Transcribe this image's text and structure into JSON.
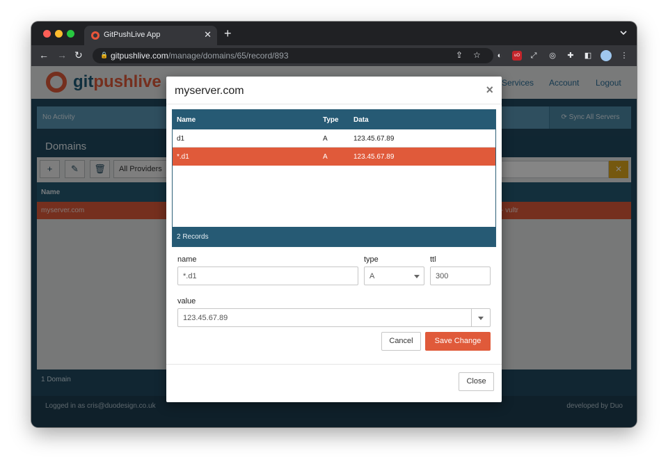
{
  "browser": {
    "tab_title": "GitPushLive App",
    "tab_close": "✕",
    "new_tab": "+",
    "tab_menu": "⌄",
    "url_host": "gitpushlive.com",
    "url_path": "/manage/domains/65/record/893",
    "icons": [
      "back-icon",
      "forward-icon",
      "reload-icon",
      "lock-icon",
      "share-icon",
      "star-icon",
      "extensions-icon",
      "sidebar-icon",
      "profile-avatar",
      "more-icon"
    ]
  },
  "app": {
    "logo_git": "git",
    "logo_push": "pushlive",
    "nav": {
      "services": "Services",
      "account": "Account",
      "logout": "Logout"
    },
    "activity": "No Activity",
    "sync_all": "Sync All Servers",
    "domains": {
      "title": "Domains",
      "providers_select": "All Providers",
      "column_name": "Name",
      "rows": [
        {
          "name": "myserver.com",
          "provider": "- vultr"
        }
      ],
      "footer": "1 Domain"
    },
    "footer": {
      "logged_in": "Logged in as cris@duodesign.co.uk",
      "developed_by": "developed by Duo"
    }
  },
  "modal": {
    "title": "myserver.com",
    "close_x": "×",
    "table": {
      "columns": [
        "Name",
        "Type",
        "Data"
      ],
      "rows": [
        {
          "name": "d1",
          "type": "A",
          "data": "123.45.67.89"
        },
        {
          "name": "*.d1",
          "type": "A",
          "data": "123.45.67.89"
        }
      ],
      "footer": "2 Records"
    },
    "form": {
      "name_label": "name",
      "name_value": "*.d1",
      "type_label": "type",
      "type_value": "A",
      "ttl_label": "ttl",
      "ttl_value": "300",
      "value_label": "value",
      "value_value": "123.45.67.89"
    },
    "buttons": {
      "cancel": "Cancel",
      "save": "Save Change",
      "close": "Close"
    }
  },
  "colors": {
    "brand_orange": "#e05a3a",
    "brand_navy": "#224a60",
    "accent_yellow": "#e0a91e"
  }
}
